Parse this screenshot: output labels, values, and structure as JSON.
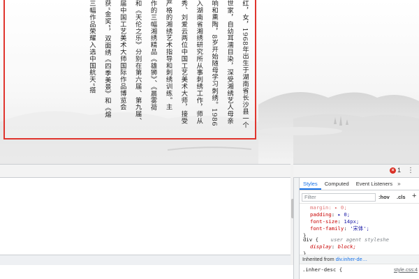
{
  "article": {
    "columns": [
      "红，女，1968年出生于湖南省长沙县一个",
      "世家，自幼耳濡目染，深受湘绣艺人母亲",
      "响和熏陶，8岁开始随母学习刺绣。1986",
      "入湖南省湘绣研究所从事刺绣工作，师从",
      "秀、刘爱云两位中国工艺美术大师，接受",
      "严格的湘绣艺术指导和刺绣训练。主",
      "作的三幅湘绣精品《雄狮》、《晨雾荷",
      "和《天伦之乐》分别在第六届、第九届、",
      "届中国工艺美术大师国际作品博览会",
      "获“金奖”，双面绣《四季美景》和《熔",
      "三幅作品荣耀入选中国航天“搭"
    ]
  },
  "devtools": {
    "error_count": "1",
    "menu_glyph": "⋮",
    "tabs": [
      "Styles",
      "Computed",
      "Event Listeners"
    ],
    "tabs_more": "»",
    "filter_placeholder": "Filter",
    "hov_label": ":hov",
    "cls_label": ".cls",
    "add_rule_label": "+",
    "rules": {
      "cut_line": "margin: ▸ 0;",
      "padding_prop": "padding",
      "padding_val": "▸ 0;",
      "fontsize_prop": "font-size",
      "fontsize_val": "14px;",
      "fontfamily_prop": "font-family",
      "fontfamily_val": "'宋体';",
      "close_brace": "}",
      "div_selector": "div {",
      "ua_label": "user agent styleshe",
      "display_prop": "display",
      "display_val": "block;",
      "div_close": "}"
    },
    "inherited_label": "Inherited from",
    "inherited_selector": "div.inher-de…",
    "next_selector": ".inher-desc {",
    "next_source": "style.css:4"
  }
}
